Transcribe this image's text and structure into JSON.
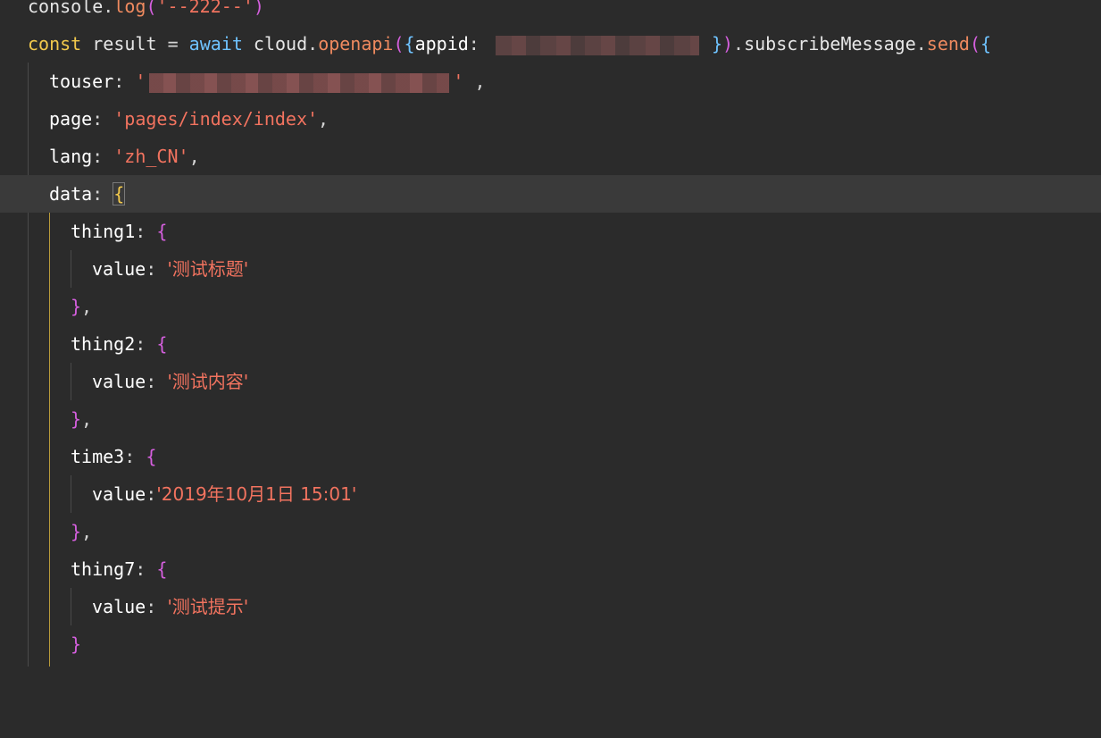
{
  "code": {
    "line0": {
      "obj": "console",
      "dot": ".",
      "method": "log",
      "open": "(",
      "str": "'--222--'",
      "close": ")"
    },
    "line1": {
      "kw": "const",
      "var": "result",
      "eq": "=",
      "await": "await",
      "obj": "cloud",
      "dot": ".",
      "method": "openapi",
      "open_paren": "(",
      "open_brace": "{",
      "key": "appid",
      "colon": ":",
      "close_brace": "}",
      "close_paren": ")",
      "dot2": ".",
      "prop": "subscribeMessage",
      "dot3": ".",
      "method2": "send",
      "open_paren2": "(",
      "open_brace2": "{"
    },
    "line2": {
      "key": "touser",
      "colon": ":",
      "quote_open": "'",
      "quote_close": "'",
      "comma": " ,"
    },
    "line3": {
      "key": "page",
      "colon": ":",
      "value": "'pages/index/index'",
      "comma": ","
    },
    "line4": {
      "key": "lang",
      "colon": ":",
      "value": "'zh_CN'",
      "comma": ","
    },
    "line5": {
      "key": "data",
      "colon": ":",
      "brace": "{"
    },
    "line6": {
      "key": "thing1",
      "colon": ":",
      "brace": "{"
    },
    "line7": {
      "key": "value",
      "colon": ":",
      "value": "'测试标题'"
    },
    "line8": {
      "brace": "}",
      "comma": ","
    },
    "line9": {
      "key": "thing2",
      "colon": ":",
      "brace": "{"
    },
    "line10": {
      "key": "value",
      "colon": ":",
      "value": "'测试内容'"
    },
    "line11": {
      "brace": "}",
      "comma": ","
    },
    "line12": {
      "key": "time3",
      "colon": ":",
      "brace": "{"
    },
    "line13": {
      "key": "value",
      "colon": ":",
      "value": "'2019年10月1日 15:01'"
    },
    "line14": {
      "brace": "}",
      "comma": ","
    },
    "line15": {
      "key": "thing7",
      "colon": ":",
      "brace": "{"
    },
    "line16": {
      "key": "value",
      "colon": ":",
      "value": "'测试提示'"
    },
    "line17": {
      "brace": "}"
    }
  },
  "colors": {
    "background": "#2b2b2b",
    "current_line": "#3a3a3a",
    "keyword": "#f2c94c",
    "string": "#f2735f",
    "function": "#ef8a5f",
    "bracket": "#d55fde",
    "await": "#6fc3ff"
  }
}
